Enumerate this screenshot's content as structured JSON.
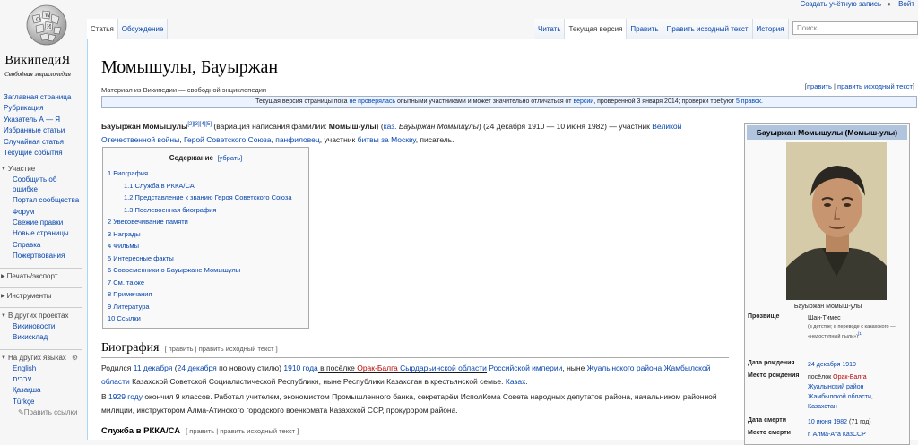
{
  "logo": {
    "title": "ВикипедиЯ",
    "tagline": "Свободная энциклопедия"
  },
  "personal": {
    "create": "Создать учётную запись",
    "login": "Войт"
  },
  "tabs": {
    "article": "Статья",
    "talk": "Обсуждение",
    "read": "Читать",
    "current": "Текущая версия",
    "edit": "Править",
    "edit_source": "Править исходный текст",
    "history": "История"
  },
  "search": {
    "placeholder": "Поиск"
  },
  "sidebar": {
    "main": [
      "Заглавная страница",
      "Рубрикация",
      "Указатель А — Я",
      "Избранные статьи",
      "Случайная статья",
      "Текущие события"
    ],
    "participation_heading": "Участие",
    "participation": [
      "Сообщить об",
      "ошибке",
      "Портал сообщества",
      "Форум",
      "Свежие правки",
      "Новые страницы",
      "Справка",
      "Пожертвования"
    ],
    "print": "Печать/экспорт",
    "tools": "Инструменты",
    "other_projects": "В других проектах",
    "projects": [
      "Викиновости",
      "Викисклад"
    ],
    "languages_heading": "На других языках",
    "languages": [
      "English",
      "עברית",
      "Қазақша",
      "Türkçe"
    ],
    "edit_links": "Править ссылки"
  },
  "article": {
    "title": "Момышулы, Бауыржан",
    "from": "Материал из Википедии — свободной энциклопедии",
    "edit_links": [
      "править",
      "править исходный текст"
    ],
    "notice": {
      "before": "Текущая версия страницы пока ",
      "link1": "не проверялась",
      "middle": " опытными участниками и может значительно отличаться от ",
      "link2": "версии",
      "after": ", проверенной 3 января 2014; проверки требуют ",
      "link3": "5 правок"
    },
    "lead": {
      "name": "Бауыржан Момышулы",
      "refs": "[2][3][4][5]",
      "t1": " (вариация написания фамилии: ",
      "alt": "Момыш-улы",
      "t2": ") (",
      "lang": "каз.",
      "kz_name": " Бауыржан Момышұлы",
      "t3": ") (24 декабря 1910 — 10 июня 1982) — участник ",
      "war": "Великой Отечественной войны",
      "t4": ", ",
      "hero": "Герой Советского Союза",
      "t5": ", ",
      "panf": "панфиловец",
      "t6": ", участник ",
      "battle": "битвы за Москву",
      "t7": ", писатель."
    },
    "toc": {
      "title": "Содержание",
      "hide": "[убрать]",
      "items": [
        {
          "text": "1 Биография",
          "sub": false
        },
        {
          "text": "1.1 Служба в РККА/СА",
          "sub": true
        },
        {
          "text": "1.2 Представление к званию Героя Советского Союза",
          "sub": true
        },
        {
          "text": "1.3 Послевоенная биография",
          "sub": true
        },
        {
          "text": "2 Увековечивание памяти",
          "sub": false
        },
        {
          "text": "3 Награды",
          "sub": false
        },
        {
          "text": "4 Фильмы",
          "sub": false
        },
        {
          "text": "5 Интересные факты",
          "sub": false
        },
        {
          "text": "6 Современники о Бауыржане Момышулы",
          "sub": false
        },
        {
          "text": "7 См. также",
          "sub": false
        },
        {
          "text": "8 Примечания",
          "sub": false
        },
        {
          "text": "9 Литература",
          "sub": false
        },
        {
          "text": "10 Ссылки",
          "sub": false
        }
      ]
    },
    "bio_heading": "Биография",
    "bio_edit": "[ править | править исходный текст ]",
    "para1": {
      "a": "Родился ",
      "d1": "11 декабря",
      "b": " (",
      "d2": "24 декабря",
      "c": " по новому стилю) ",
      "y": "1910 года",
      "d": " в посёлке ",
      "village": "Орак-Балга",
      "e": " ",
      "oblast": "Сырдарьинской области",
      "f": " ",
      "empire": "Российской империи",
      "g": ", ныне ",
      "district": "Жуалынского района",
      "h": " ",
      "jambyl": "Жамбылской области",
      "i": " Казахской Советской Социалистической Республики, ныне Республики Казахстан в крестьянской семье. ",
      "kazakh": "Казах",
      "j": "."
    },
    "para2": {
      "a": "В ",
      "year": "1929 году",
      "b": " окончил 9 классов. Работал учителем, экономистом Промышленного банка, секретарём ИсполКома Совета народных депутатов района, начальником районной милиции, инструктором Алма-Атинского городского военкомата Казахской ССР, прокурором района."
    },
    "service_heading": "Служба в РККА/СА",
    "service_edit": "[ править | править исходный текст ]"
  },
  "infobox": {
    "title": "Бауыржан Момышулы (Момыш-улы)",
    "caption": "Бауыржан Момыш-улы",
    "nickname_label": "Прозвище",
    "nickname": "Шан-Тимес",
    "nickname_note": "(в детстве; в переводе с казахского — «недоступный пыли»)",
    "nickname_ref": "[1]",
    "birth_label": "Дата рождения",
    "birth": "24 декабря 1910",
    "birthplace_label": "Место рождения",
    "birthplace_a": "посёлок ",
    "birthplace_village": "Орак-Балга",
    "birthplace_district": "Жуалынский район",
    "birthplace_oblast": "Жамбылской области,",
    "birthplace_country": "Казахстан",
    "death_label": "Дата смерти",
    "death": "10 июня 1982",
    "death_age": " (71 год)",
    "deathplace_label": "Место смерти",
    "deathplace": "г. Алма-Ата КазССР"
  },
  "colors": {
    "link": "#0645ad",
    "redlink": "#ba0000",
    "infobox_header": "#b0c4de",
    "notice_bg": "#eaf3ff"
  }
}
